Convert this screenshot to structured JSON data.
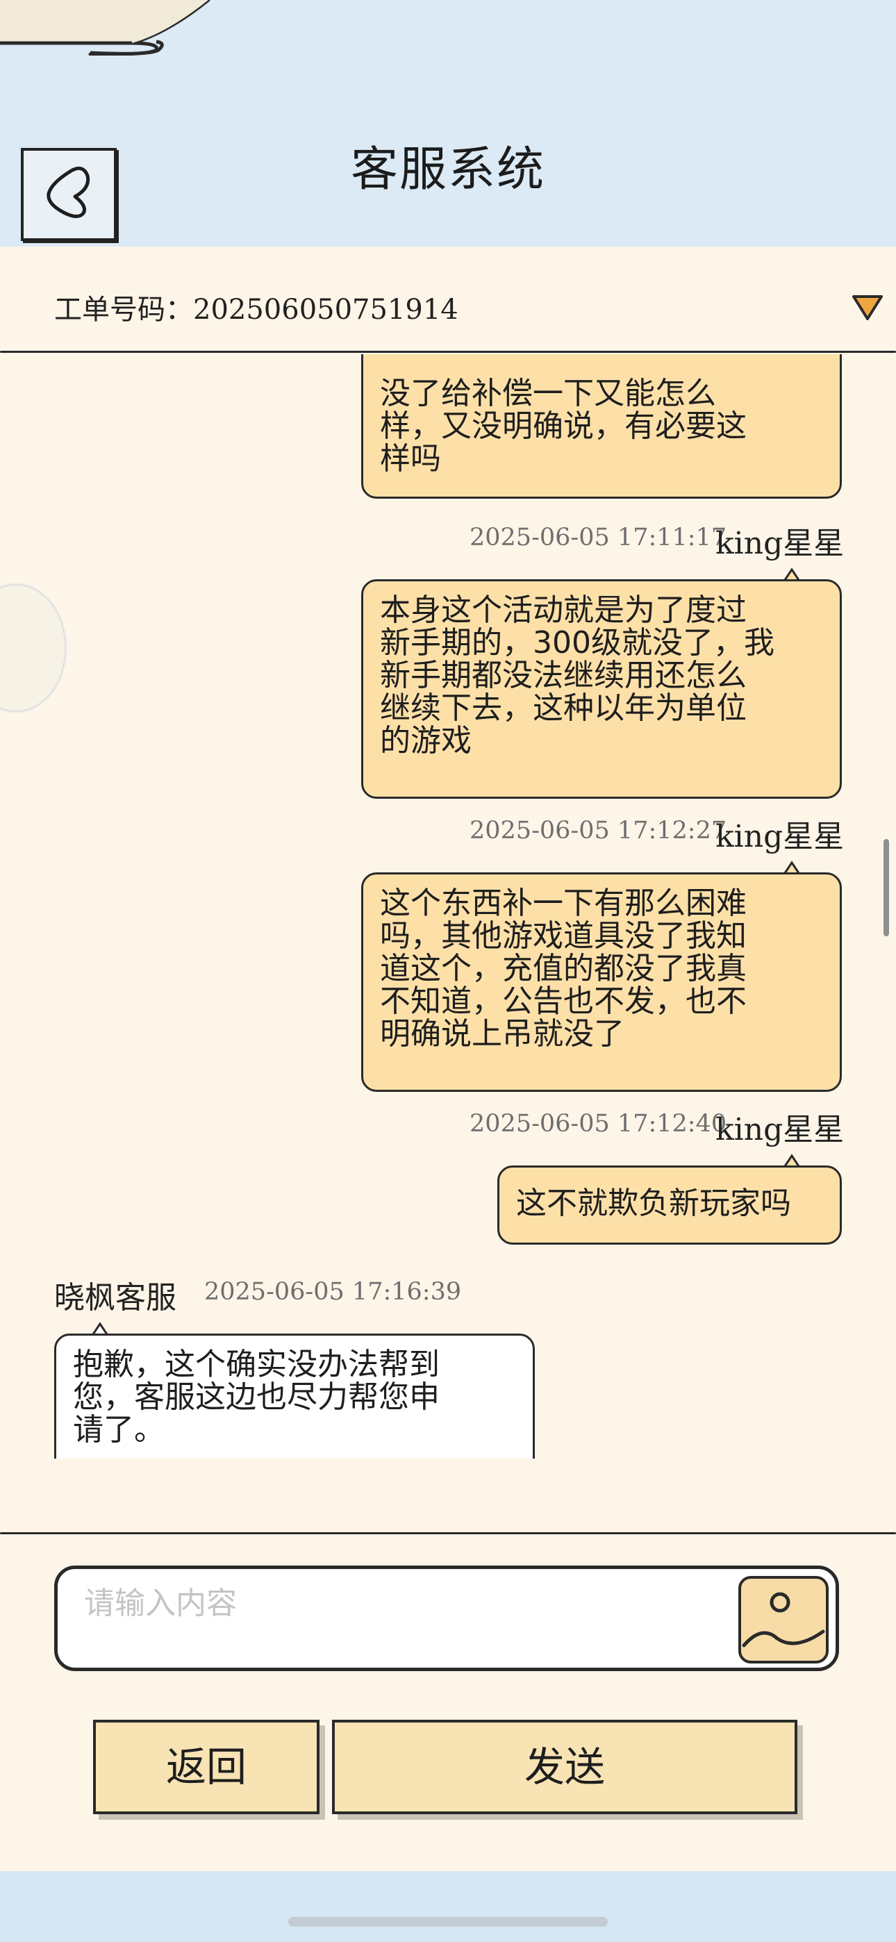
{
  "header": {
    "title": "客服系统"
  },
  "ticket": {
    "label": "工单号码：2025060507519​14"
  },
  "messages": [
    {
      "role": "user",
      "text": "没了给补偿一下又能怎么\n样，又没明确说，有必要这\n样吗",
      "partial_top": true
    },
    {
      "role": "user",
      "time": "2025-06-05 17:11:17",
      "name": "king星星",
      "text": "本身这个活动就是为了度过\n新手期的，300级就没了，我\n新手期都没法继续用还怎么\n继续下去，这种以年为单位\n的游戏"
    },
    {
      "role": "user",
      "time": "2025-06-05 17:12:27",
      "name": "king星星",
      "text": "这个东西补一下有那么困难\n吗，其他游戏道具没了我知\n道这个，充值的都没了我真\n不知道，公告也不发，也不\n明确说上吊就没了"
    },
    {
      "role": "user",
      "time": "2025-06-05 17:12:40",
      "name": "king星星",
      "text": "这不就欺负新玩家吗"
    },
    {
      "role": "agent",
      "time": "2025-06-05 17:16:39",
      "name": "晓枫客服",
      "text": "抱歉，这个确实没办法帮到\n您，客服这边也尽力帮您申\n请了。"
    }
  ],
  "input": {
    "placeholder": "请输入内容",
    "value": ""
  },
  "buttons": {
    "back_label": "返回",
    "send_label": "发送"
  },
  "colors": {
    "header_bg": "#dbeaf4",
    "panel_bg": "#fdf5e8",
    "user_bubble": "#fde0a8",
    "agent_bubble": "#ffffff",
    "button_bg": "#f8e3b4",
    "caret": "#f0a640"
  }
}
